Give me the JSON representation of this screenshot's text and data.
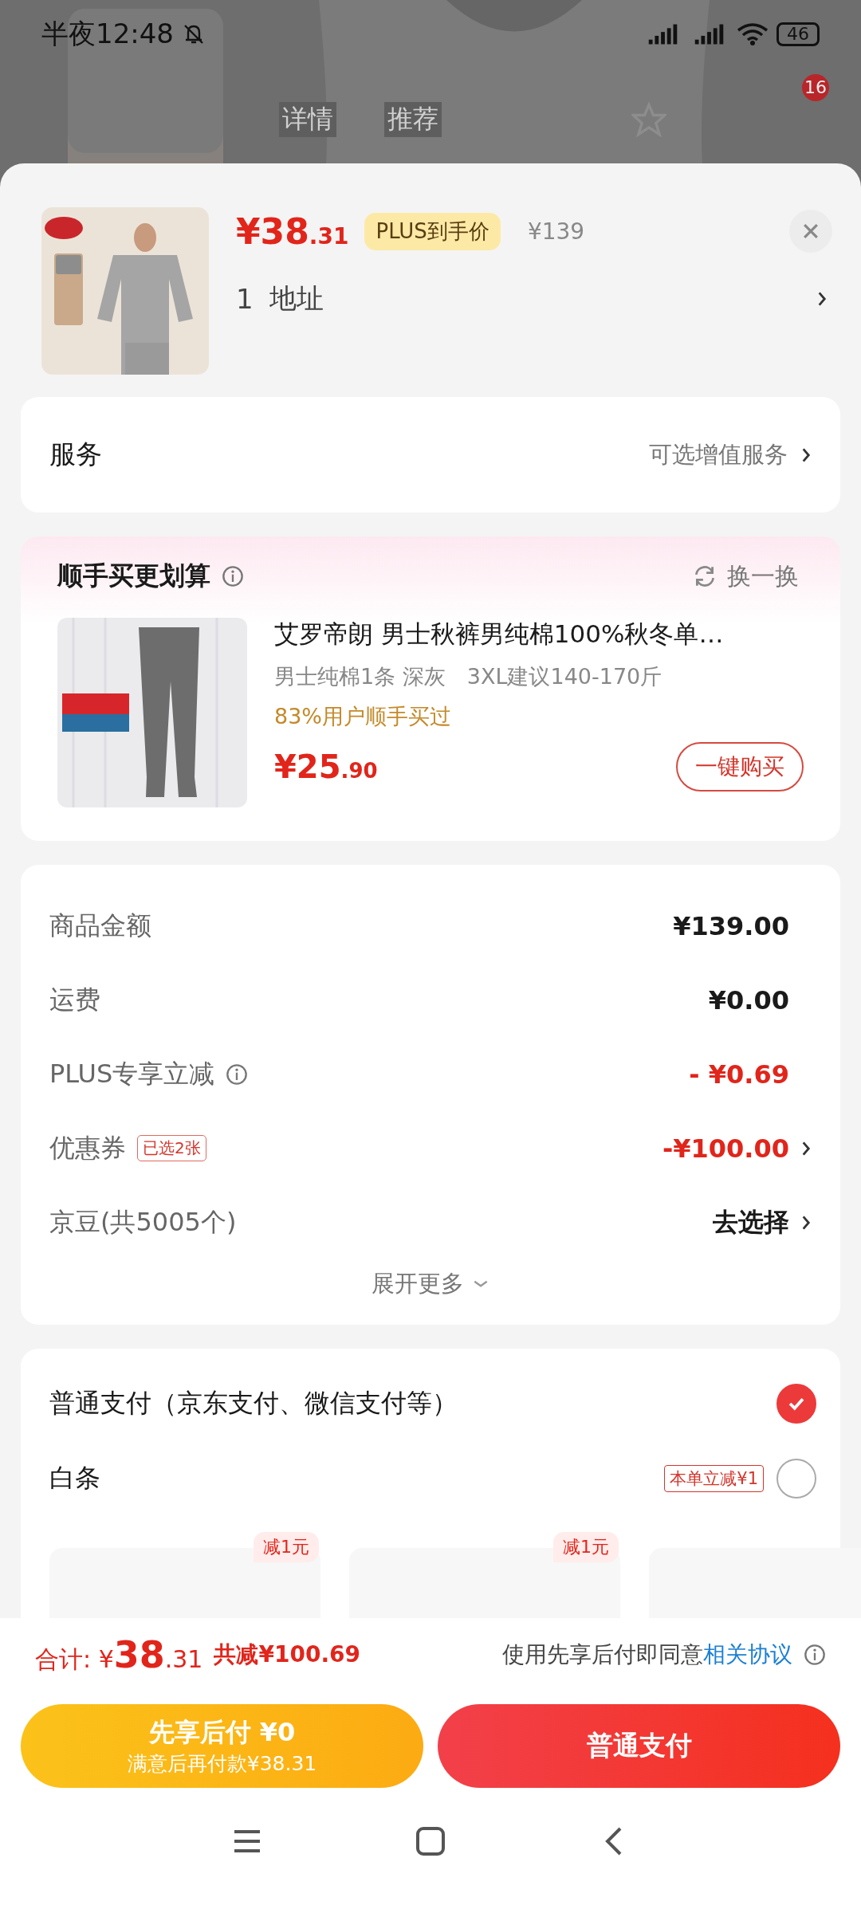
{
  "status_bar": {
    "time": "半夜12:48",
    "battery": "46"
  },
  "background_page": {
    "tabs": [
      "详情",
      "推荐"
    ],
    "cart_badge": "16"
  },
  "product": {
    "price_yuan": "¥38",
    "price_cents": ".31",
    "plus_tag": "PLUS到手价",
    "original_price": "¥139",
    "quantity": "1",
    "address": "地址"
  },
  "service": {
    "label": "服务",
    "value": "可选增值服务"
  },
  "upsell": {
    "title": "顺手买更划算",
    "refresh": "换一换",
    "name": "艾罗帝朗 男士秋裤男纯棉100%秋冬单…",
    "spec": "男士纯棉1条 深灰　3XL建议140-170斤",
    "social": "83%用户顺手买过",
    "price_yuan": "¥25",
    "price_cents": ".90",
    "button": "一键购买"
  },
  "fees": [
    {
      "label": "商品金额",
      "value": "¥139.00",
      "discount": false,
      "info": false,
      "arrow": false
    },
    {
      "label": "运费",
      "value": "¥0.00",
      "discount": false,
      "info": false,
      "arrow": false
    },
    {
      "label": "PLUS专享立减",
      "value": "- ¥0.69",
      "discount": true,
      "info": true,
      "arrow": false
    },
    {
      "label": "优惠券",
      "tag": "已选2张",
      "value": "-¥100.00",
      "discount": true,
      "info": false,
      "arrow": true
    },
    {
      "label": "京豆(共5005个)",
      "value": "去选择",
      "discount": false,
      "info": false,
      "arrow": true
    }
  ],
  "expand": "展开更多",
  "payment_methods": [
    {
      "label": "普通支付（京东支付、微信支付等）",
      "selected": true
    },
    {
      "label": "白条",
      "tag": "本单立减¥1",
      "selected": false
    }
  ],
  "installments": [
    {
      "kind": "tagged",
      "tag": "减1元"
    },
    {
      "kind": "tagged",
      "tag": "减1元"
    },
    {
      "kind": "plain"
    }
  ],
  "footer": {
    "total_label": "合计:",
    "total_yuan": "¥38",
    "total_cents": ".31",
    "saved": "共减¥100.69",
    "agreement_text": "使用先享后付即同意",
    "agreement_link": "相关协议"
  },
  "buttons": {
    "later_title": "先享后付 ¥0",
    "later_subtitle": "满意后再付款¥38.31",
    "pay": "普通支付"
  }
}
